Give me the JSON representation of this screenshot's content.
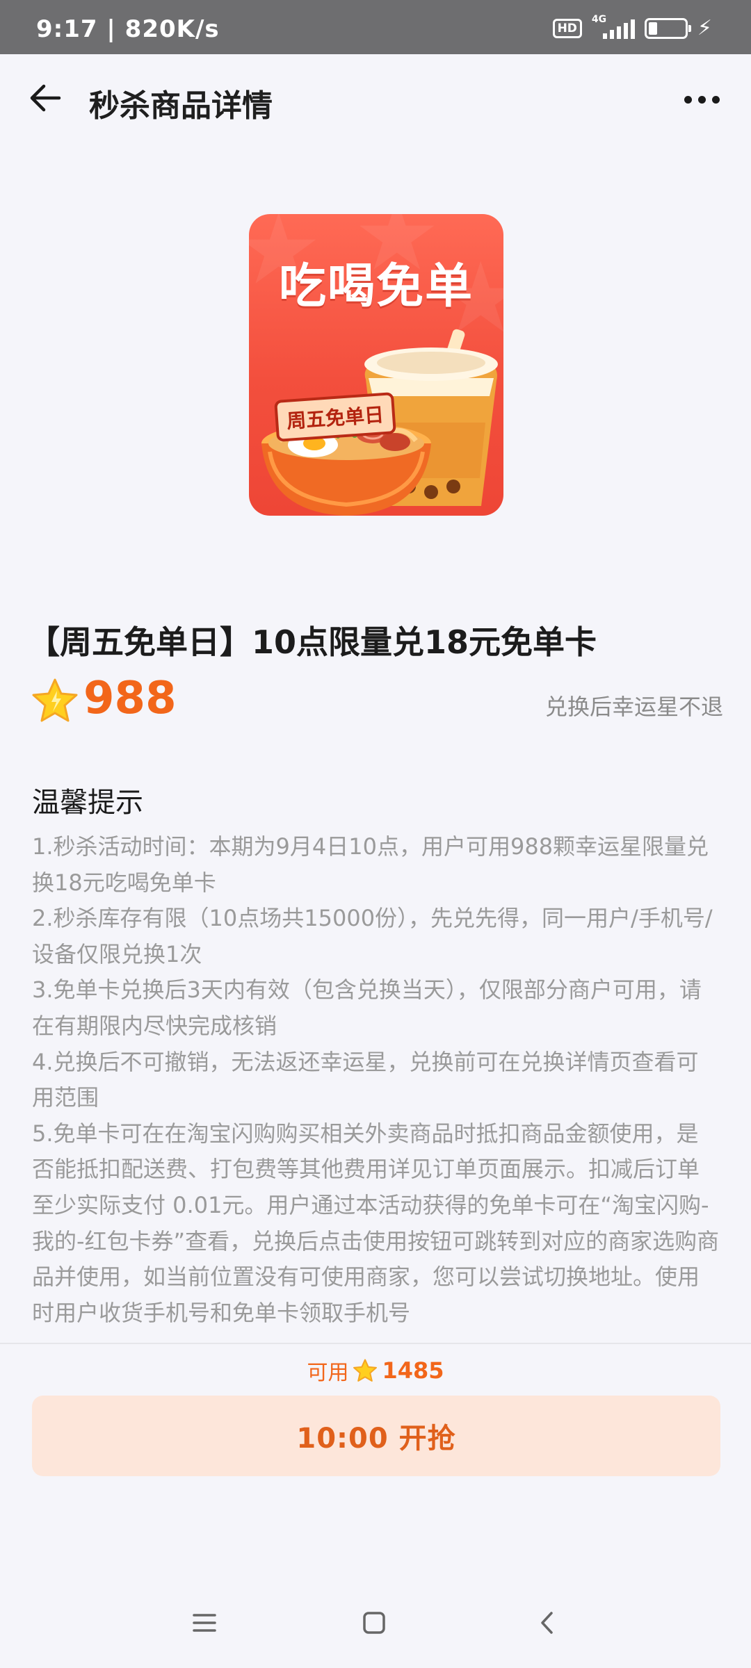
{
  "status_bar": {
    "time": "9:17 | 820K/s",
    "hd": "HD",
    "network": "4G",
    "battery": "23",
    "battery_level": 0.23,
    "icons": [
      "hd-icon",
      "signal-icon",
      "battery-icon",
      "charging-icon"
    ]
  },
  "nav": {
    "title": "秒杀商品详情",
    "back_icon": "arrow-left-icon",
    "more_icon": "more-dots-icon"
  },
  "product": {
    "image_title": "吃喝免单",
    "image_badge": "周五免单日",
    "name": "【周五免单日】10点限量兑18元免单卡",
    "price": "988",
    "price_icon": "lucky-star-icon",
    "price_note": "兑换后幸运星不退"
  },
  "tips": {
    "title": "温馨提示",
    "items": [
      "1.秒杀活动时间：本期为9月4日10点，用户可用988颗幸运星限量兑换18元吃喝免单卡",
      "2.秒杀库存有限（10点场共15000份），先兑先得，同一用户/手机号/设备仅限兑换1次",
      "3.免单卡兑换后3天内有效（包含兑换当天），仅限部分商户可用，请在有期限内尽快完成核销",
      "4.兑换后不可撤销，无法返还幸运星，兑换前可在兑换详情页查看可用范围",
      "5.免单卡可在在淘宝闪购购买相关外卖商品时抵扣商品金额使用，是否能抵扣配送费、打包费等其他费用详见订单页面展示。扣减后订单至少实际支付 0.01元。用户通过本活动获得的免单卡可在“淘宝闪购-我的-红包卡券”查看，兑换后点击使用按钮可跳转到对应的商家选购商品并使用，如当前位置没有可使用商家，您可以尝试切换地址。使用时用户收货手机号和免单卡领取手机号"
    ]
  },
  "bottom": {
    "available_label": "可用",
    "available_value": "1485",
    "button_label": "10:00 开抢"
  },
  "colors": {
    "accent": "#f2661a",
    "button_bg": "#fde6da",
    "status_bar_bg": "#6e6e70",
    "page_bg": "#f5f5fa",
    "card_red": "#f34f3d"
  },
  "system_nav": {
    "icons": [
      "menu-icon",
      "home-icon",
      "back-icon"
    ]
  }
}
